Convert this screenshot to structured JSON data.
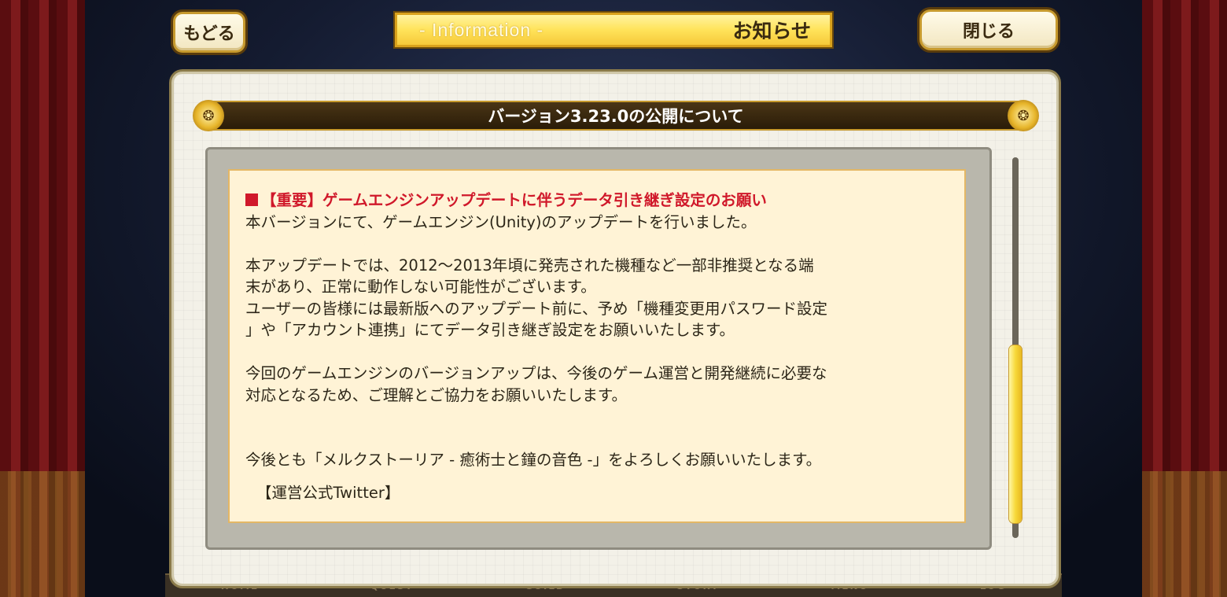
{
  "header": {
    "back_label": "もどる",
    "title_en": "- Information -",
    "title_jp": "お知らせ",
    "close_label": "閉じる"
  },
  "notice": {
    "title": "バージョン3.23.0の公開について",
    "important_heading": "【重要】ゲームエンジンアップデートに伴うデータ引き継ぎ設定のお願い",
    "lines": [
      "本バージョンにて、ゲームエンジン(Unity)のアップデートを行いました。",
      "本アップデートでは、2012～2013年頃に発売された機種など一部非推奨となる端",
      "末があり、正常に動作しない可能性がございます。",
      "ユーザーの皆様には最新版へのアップデート前に、予め「機種変更用パスワード設定",
      "」や「アカウント連携」にてデータ引き継ぎ設定をお願いいたします。",
      "今回のゲームエンジンのバージョンアップは、今後のゲーム運営と開発継続に必要な",
      "対応となるため、ご理解とご協力をお願いいたします。",
      "今後とも「メルクストーリア - 癒術士と鐘の音色 -」をよろしくお願いいたします。"
    ],
    "twitter_label": "【運営公式Twitter】"
  },
  "bottom_nav": [
    "- HOME -",
    "- QUEST -",
    "- GUILD -",
    "- STORY -",
    "- MENU -",
    "- LOG -"
  ],
  "colors": {
    "important_red": "#d0182a",
    "gold": "#c79a2e",
    "content_bg": "#fff3d6"
  },
  "icons": {
    "ornament": "gold-swirl-icon"
  }
}
